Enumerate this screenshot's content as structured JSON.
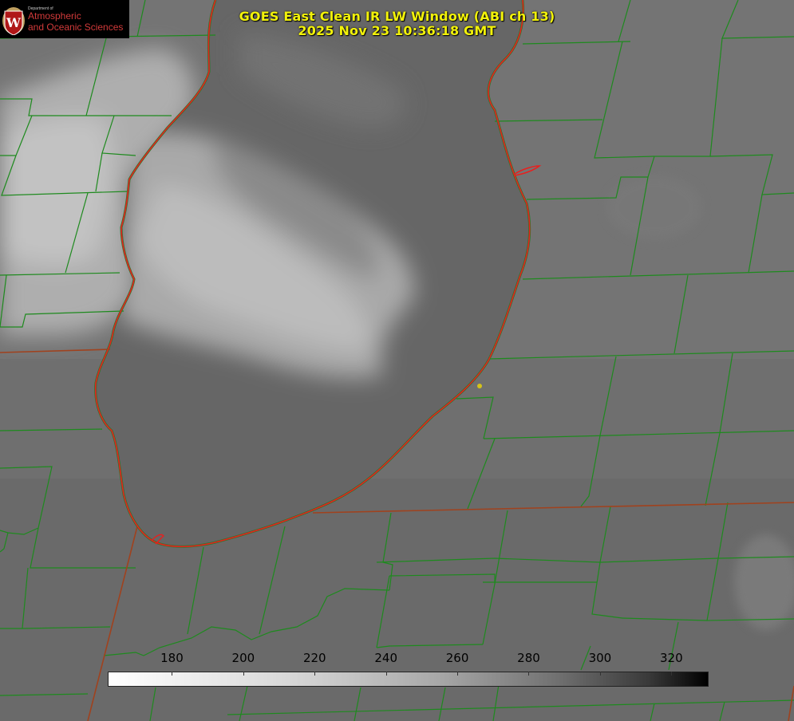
{
  "title": {
    "line1": "GOES East Clean IR LW Window (ABI ch 13)",
    "line2": "2025 Nov 23 10:36:18 GMT"
  },
  "logo": {
    "department": "Department of",
    "line1": "Atmospheric",
    "line2": "and Oceanic Sciences",
    "seal_letter": "W"
  },
  "colorbar": {
    "ticks": [
      "180",
      "200",
      "220",
      "240",
      "260",
      "280",
      "300",
      "320"
    ],
    "range": [
      162,
      330
    ],
    "scale": "white-to-black"
  },
  "colors": {
    "county_lines": "#1e8a1e",
    "state_lines": "#a0421e",
    "coastline_red": "#e8201e",
    "title_text": "#f2f20a",
    "marker": "#d4c21a"
  },
  "map": {
    "lake": "Lake Michigan",
    "marker": "city-location-dot"
  }
}
